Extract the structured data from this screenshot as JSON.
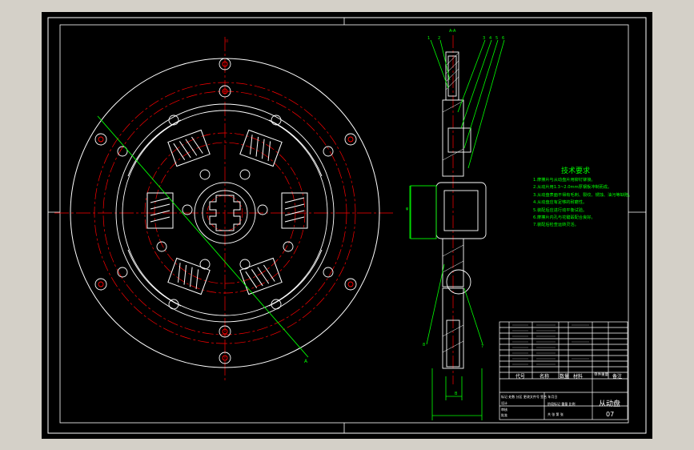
{
  "drawing": {
    "background_color": "#000000",
    "line_color": "#ffffff",
    "centerline_color": "#ff0000",
    "leader_color": "#00ff00",
    "accent_color": "#00ffff"
  },
  "technical_requirements": {
    "title": "技术要求",
    "items": [
      "1.摩擦片与从动盘片用铆钉铆接。",
      "2.从动片用1.3~2.0mm厚钢板冲制而成。",
      "3.从动盘表面不得有毛刺、裂纹、锈蚀、油污等缺陷。",
      "4.从动盘应有足够的耐磨性。",
      "5.装配后应进行动平衡试验。",
      "6.摩擦片内孔与花键毂配合良好。",
      "7.装配后检查运转灵活。"
    ]
  },
  "title_block": {
    "part_name": "从动盘",
    "drawing_code": "07",
    "header_labels": [
      "代号",
      "名称",
      "数量",
      "材料",
      "单件重量",
      "备注"
    ],
    "revision_label": "标记 处数 分区 更改文件号 签名 年月日",
    "scale_label": "阶段标记 重量 比例",
    "designer_label": "设计",
    "checker_label": "审核",
    "approver_label": "批准",
    "sheet_label": "共 张 第 张"
  },
  "dimensions": {
    "spline_dim": "φ",
    "width_dim": "B"
  }
}
